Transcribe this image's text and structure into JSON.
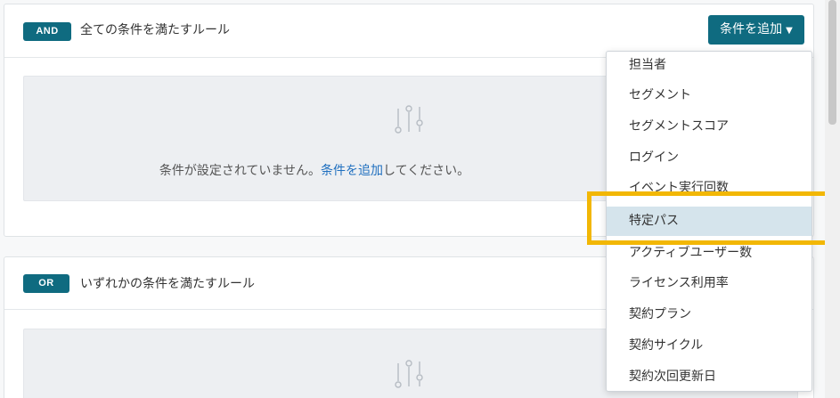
{
  "rule_and": {
    "operator": "AND",
    "title": "全ての条件を満たすルール",
    "empty_message_before": "条件が設定されていません。",
    "empty_message_link": "条件を追加",
    "empty_message_after": "してください。"
  },
  "rule_or": {
    "operator": "OR",
    "title": "いずれかの条件を満たすルール"
  },
  "add_condition_button": {
    "label": "条件を追加",
    "caret": "▼"
  },
  "condition_menu": {
    "items": [
      "担当者",
      "セグメント",
      "セグメントスコア",
      "ログイン",
      "イベント実行回数",
      "特定パス",
      "アクティブユーザー数",
      "ライセンス利用率",
      "契約プラン",
      "契約サイクル",
      "契約次回更新日"
    ],
    "hovered": "特定パス"
  },
  "colors": {
    "accent": "#0f6b80",
    "link": "#1f6fbf",
    "hover": "#d5e4ec",
    "highlight": "#f2b705"
  }
}
